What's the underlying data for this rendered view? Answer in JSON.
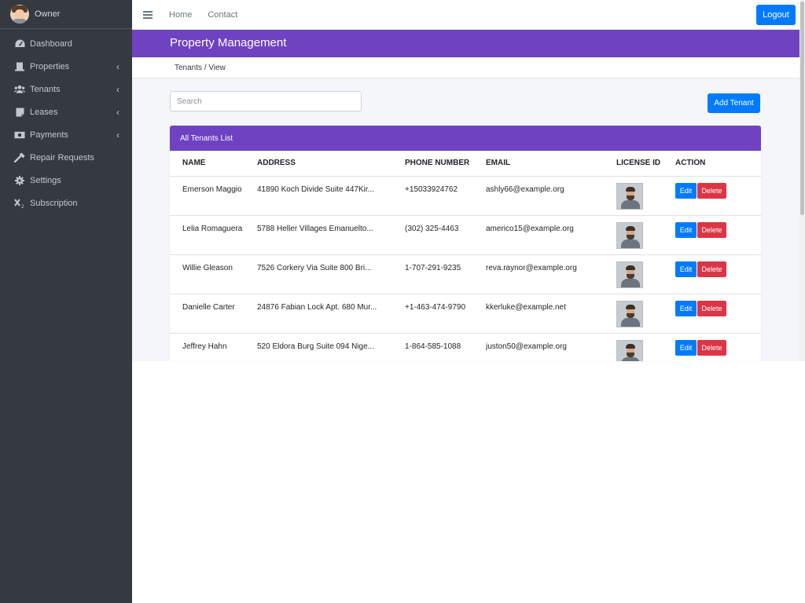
{
  "sidebar": {
    "user": "Owner",
    "items": [
      {
        "label": "Dashboard",
        "icon": "dashboard-icon",
        "chevron": ""
      },
      {
        "label": "Properties",
        "icon": "building-icon",
        "chevron": "‹"
      },
      {
        "label": "Tenants",
        "icon": "users-icon",
        "chevron": "‹"
      },
      {
        "label": "Leases",
        "icon": "file-icon",
        "chevron": "‹"
      },
      {
        "label": "Payments",
        "icon": "money-icon",
        "chevron": "‹"
      },
      {
        "label": "Repair Requests",
        "icon": "hammer-icon",
        "chevron": ""
      },
      {
        "label": "Settings",
        "icon": "gear-icon",
        "chevron": ""
      },
      {
        "label": "Subscription",
        "icon": "subscript-icon",
        "chevron": ""
      }
    ]
  },
  "topbar": {
    "home": "Home",
    "contact": "Contact",
    "logout": "Logout"
  },
  "header": {
    "title": "Property Management",
    "breadcrumb": "Tenants / View"
  },
  "toolbar": {
    "search_placeholder": "Search",
    "search_value": "",
    "add_label": "Add Tenant"
  },
  "table": {
    "title": "All Tenants List",
    "columns": [
      "NAME",
      "ADDRESS",
      "PHONE NUMBER",
      "EMAIL",
      "LICENSE ID",
      "ACTION"
    ],
    "edit_label": "Edit",
    "delete_label": "Delete",
    "rows": [
      {
        "name": "Emerson Maggio",
        "address": "41890 Koch Divide Suite 447Kir...",
        "phone": "+15033924762",
        "email": "ashly66@example.org"
      },
      {
        "name": "Lelia Romaguera",
        "address": "5788 Heller Villages Emanuelto...",
        "phone": "(302) 325-4463",
        "email": "americo15@example.org"
      },
      {
        "name": "Willie Gleason",
        "address": "7526 Corkery Via Suite 800 Bri...",
        "phone": "1-707-291-9235",
        "email": "reva.raynor@example.org"
      },
      {
        "name": "Danielle Carter",
        "address": "24876 Fabian Lock Apt. 680 Mur...",
        "phone": "+1-463-474-9790",
        "email": "kkerluke@example.net"
      },
      {
        "name": "Jeffrey Hahn",
        "address": "520 Eldora Burg Suite 094 Nige...",
        "phone": "1-864-585-1088",
        "email": "juston50@example.org"
      }
    ]
  },
  "colors": {
    "sidebar_bg": "#343a40",
    "accent_purple": "#6f42c1",
    "primary_blue": "#007bff",
    "danger_red": "#dc3545"
  }
}
